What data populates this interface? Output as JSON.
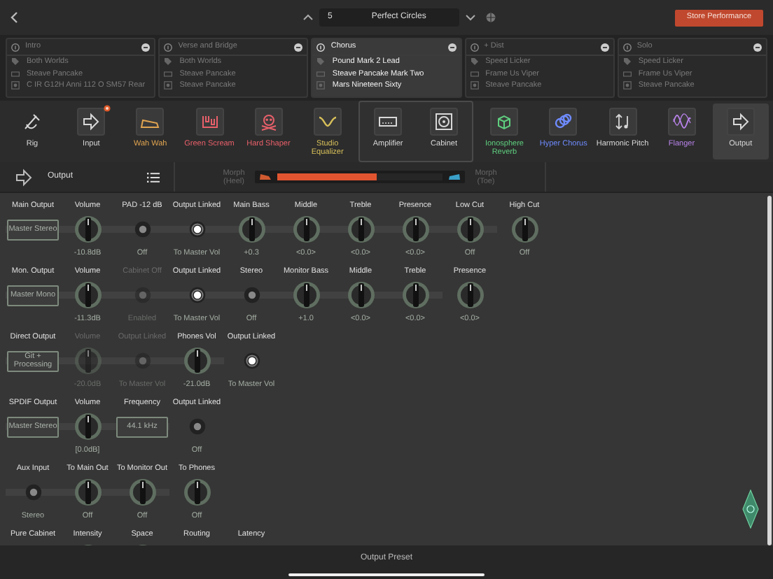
{
  "top_bar": {
    "performance_number": "5",
    "performance_name": "Perfect Circles",
    "store_button": "Store Performance"
  },
  "slots": [
    {
      "name": "Intro",
      "selected": false,
      "rig": "Both Worlds",
      "amp": "Steave Pancake",
      "cabinet": "C IR G12H Anni 112 O SM57 Rear"
    },
    {
      "name": "Verse and Bridge",
      "selected": false,
      "rig": "Both Worlds",
      "amp": "Steave Pancake",
      "cabinet": "Steave Pancake"
    },
    {
      "name": "Chorus",
      "selected": true,
      "rig": "Pound Mark 2 Lead",
      "amp": "Steave Pancake Mark Two",
      "cabinet": "Mars Nineteen Sixty"
    },
    {
      "name": "+ Dist",
      "selected": false,
      "rig": "Speed Licker",
      "amp": "Frame Us Viper",
      "cabinet": "Steave Pancake"
    },
    {
      "name": "Solo",
      "selected": false,
      "rig": "Speed Licker",
      "amp": "Frame Us Viper",
      "cabinet": "Steave Pancake"
    }
  ],
  "effects": [
    {
      "label": "Rig",
      "color": "#d8d8d8",
      "selected": false,
      "alert": false
    },
    {
      "label": "Input",
      "color": "#d8d8d8",
      "selected": false,
      "alert": true
    },
    {
      "label": "Wah Wah",
      "color": "#e0a450",
      "selected": false,
      "alert": false
    },
    {
      "label": "Green Scream",
      "color": "#e8606a",
      "selected": false,
      "alert": false
    },
    {
      "label": "Hard Shaper",
      "color": "#e8606a",
      "selected": false,
      "alert": false
    },
    {
      "label": "Studio Equalizer",
      "color": "#d8c05a",
      "selected": false,
      "alert": false
    },
    {
      "group": [
        {
          "label": "Amplifier",
          "color": "#d8d8d8",
          "selected": false,
          "alert": false
        },
        {
          "label": "Cabinet",
          "color": "#d8d8d8",
          "selected": false,
          "alert": false
        }
      ]
    },
    {
      "label": "Ionosphere Reverb",
      "color": "#5fcf7f",
      "selected": false,
      "alert": false
    },
    {
      "label": "Hyper Chorus",
      "color": "#6f8cff",
      "selected": false,
      "alert": false
    },
    {
      "label": "Harmonic Pitch",
      "color": "#d8d8d8",
      "selected": false,
      "alert": false
    },
    {
      "label": "Flanger",
      "color": "#b782e8",
      "selected": false,
      "alert": false
    },
    {
      "label": "Output",
      "color": "#d8d8d8",
      "selected": true,
      "alert": false
    }
  ],
  "output_bar": {
    "title": "Output",
    "morph": {
      "left_label": "Morph (Heel)",
      "right_label": "Morph (Toe)",
      "level": 0.6
    }
  },
  "rows": [
    {
      "items": [
        {
          "kind": "button",
          "label": "Main Output",
          "text": "Master Stereo"
        },
        {
          "kind": "knob",
          "label": "Volume",
          "value": "-10.8dB",
          "disabled": false
        },
        {
          "kind": "led",
          "label": "PAD -12 dB",
          "on": false,
          "value": "Off",
          "disabled": false
        },
        {
          "kind": "led",
          "label": "Output Linked",
          "on": true,
          "value": "To Master Vol",
          "disabled": false
        },
        {
          "kind": "knob",
          "label": "Main Bass",
          "value": "+0.3",
          "disabled": false
        },
        {
          "kind": "knob",
          "label": "Middle",
          "value": "<0.0>",
          "disabled": false
        },
        {
          "kind": "knob",
          "label": "Treble",
          "value": "<0.0>",
          "disabled": false
        },
        {
          "kind": "knob",
          "label": "Presence",
          "value": "<0.0>",
          "disabled": false
        },
        {
          "kind": "knob",
          "label": "Low Cut",
          "value": "Off",
          "disabled": false
        },
        {
          "kind": "knob",
          "label": "High Cut",
          "value": "Off",
          "disabled": false
        }
      ]
    },
    {
      "items": [
        {
          "kind": "button",
          "label": "Mon. Output",
          "text": "Master Mono"
        },
        {
          "kind": "knob",
          "label": "Volume",
          "value": "-11.3dB",
          "disabled": false
        },
        {
          "kind": "led",
          "label": "Cabinet Off",
          "on": false,
          "value": "Enabled",
          "disabled": true
        },
        {
          "kind": "led",
          "label": "Output Linked",
          "on": true,
          "value": "To Master Vol",
          "disabled": false
        },
        {
          "kind": "led",
          "label": "Stereo",
          "on": false,
          "value": "Off",
          "disabled": false
        },
        {
          "kind": "knob",
          "label": "Monitor Bass",
          "value": "+1.0",
          "disabled": false
        },
        {
          "kind": "knob",
          "label": "Middle",
          "value": "<0.0>",
          "disabled": false
        },
        {
          "kind": "knob",
          "label": "Treble",
          "value": "<0.0>",
          "disabled": false
        },
        {
          "kind": "knob",
          "label": "Presence",
          "value": "<0.0>",
          "disabled": false
        }
      ]
    },
    {
      "items": [
        {
          "kind": "button",
          "label": "Direct Output",
          "text": "Git + Processing"
        },
        {
          "kind": "knob",
          "label": "Volume",
          "value": "-20.0dB",
          "disabled": true
        },
        {
          "kind": "led",
          "label": "Output Linked",
          "on": false,
          "value": "To Master Vol",
          "disabled": true
        },
        {
          "kind": "knob",
          "label": "Phones Vol",
          "value": "-21.0dB",
          "disabled": false
        },
        {
          "kind": "led",
          "label": "Output Linked",
          "on": true,
          "value": "To Master Vol",
          "disabled": false
        }
      ]
    },
    {
      "items": [
        {
          "kind": "button",
          "label": "SPDIF Output",
          "text": "Master Stereo"
        },
        {
          "kind": "knob",
          "label": "Volume",
          "value": "[0.0dB]",
          "disabled": false
        },
        {
          "kind": "box",
          "label": "Frequency",
          "text": "44.1 kHz"
        },
        {
          "kind": "led",
          "label": "Output Linked",
          "on": false,
          "value": "Off",
          "disabled": false
        }
      ]
    },
    {
      "items": [
        {
          "kind": "led",
          "label": "Aux Input",
          "on": false,
          "value": "Stereo",
          "disabled": false
        },
        {
          "kind": "knob",
          "label": "To Main Out",
          "value": "Off",
          "disabled": false
        },
        {
          "kind": "knob",
          "label": "To Monitor Out",
          "value": "Off",
          "disabled": false
        },
        {
          "kind": "knob",
          "label": "To Phones",
          "value": "Off",
          "disabled": false
        }
      ]
    },
    {
      "items": [
        {
          "kind": "label",
          "label": "Pure Cabinet"
        },
        {
          "kind": "knob",
          "label": "Intensity",
          "disabled": false
        },
        {
          "kind": "knob",
          "label": "Space",
          "disabled": false
        },
        {
          "kind": "label",
          "label": "Routing"
        },
        {
          "kind": "label",
          "label": "Latency"
        }
      ]
    }
  ],
  "bottom_bar": {
    "title": "Output Preset"
  }
}
